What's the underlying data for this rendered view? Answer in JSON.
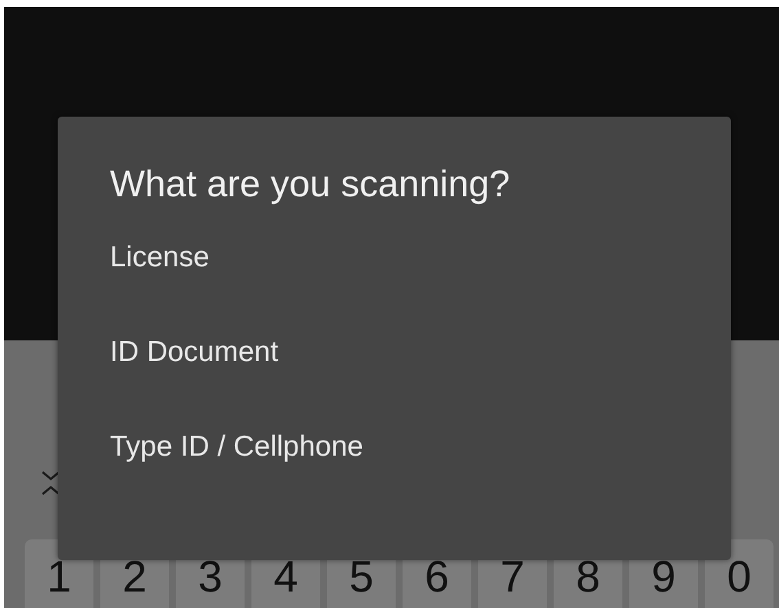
{
  "dialog": {
    "title": "What are you scanning?",
    "options": [
      {
        "label": "License",
        "selected": false
      },
      {
        "label": "ID Document",
        "selected": false
      },
      {
        "label": "Type ID / Cellphone",
        "selected": false
      }
    ]
  },
  "keyboard": {
    "number_keys": [
      "1",
      "2",
      "3",
      "4",
      "5",
      "6",
      "7",
      "8",
      "9",
      "0"
    ]
  }
}
